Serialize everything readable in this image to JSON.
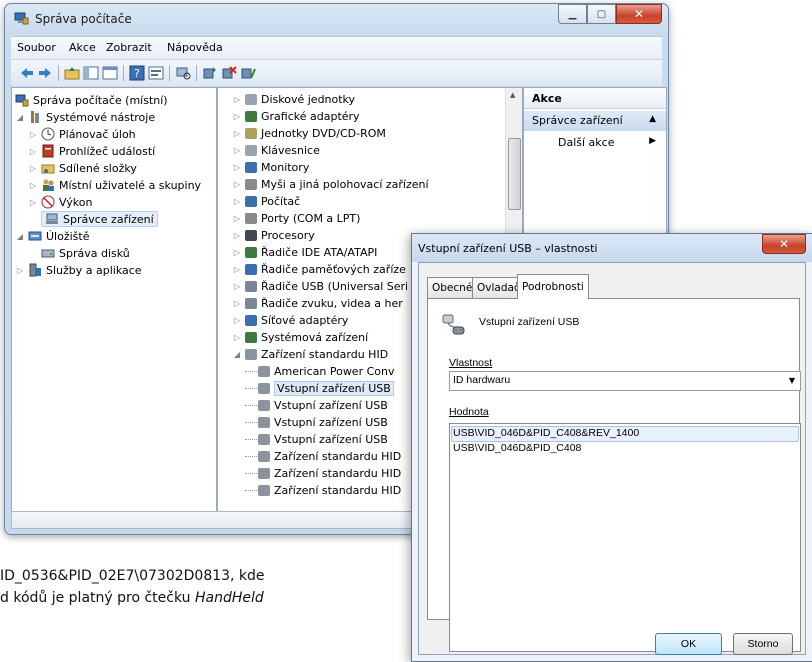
{
  "window": {
    "title": "Správa počítače",
    "menu": [
      "Soubor",
      "Akce",
      "Zobrazit",
      "Nápověda"
    ]
  },
  "tree": [
    {
      "label": "Správa počítače (místní)",
      "icon": "computer-management-icon"
    },
    {
      "label": "Systémové nástroje",
      "icon": "tools-icon"
    },
    {
      "label": "Plánovač úloh",
      "icon": "clock-icon"
    },
    {
      "label": "Prohlížeč událostí",
      "icon": "event-viewer-icon"
    },
    {
      "label": "Sdílené složky",
      "icon": "shared-folder-icon"
    },
    {
      "label": "Místní uživatelé a skupiny",
      "icon": "users-icon"
    },
    {
      "label": "Výkon",
      "icon": "performance-icon"
    },
    {
      "label": "Správce zařízení",
      "icon": "device-manager-icon"
    },
    {
      "label": "Úložiště",
      "icon": "storage-icon"
    },
    {
      "label": "Správa disků",
      "icon": "disk-icon"
    },
    {
      "label": "Služby a aplikace",
      "icon": "services-icon"
    }
  ],
  "devices": [
    "Diskové jednotky",
    "Grafické adaptéry",
    "Jednotky DVD/CD-ROM",
    "Klávesnice",
    "Monitory",
    "Myši a jiná polohovací zařízení",
    "Počítač",
    "Porty (COM a LPT)",
    "Procesory",
    "Řadiče IDE ATA/ATAPI",
    "Řadiče paměťových zaříze",
    "Řadiče USB (Universal Seri",
    "Řadiče zvuku, videa a her",
    "Síťové adaptéry",
    "Systémová zařízení",
    "Zařízení standardu HID",
    "American Power Conv",
    "Vstupní zařízení USB",
    "Vstupní zařízení USB",
    "Vstupní zařízení USB",
    "Vstupní zařízení USB",
    "Zařízení standardu HID",
    "Zařízení standardu HID",
    "Zařízení standardu HID"
  ],
  "actions": {
    "header": "Akce",
    "section": "Správce zařízení",
    "more": "Další akce"
  },
  "dialog": {
    "title": "Vstupní zařízení USB – vlastnosti",
    "tabs": [
      "Obecné",
      "Ovladač",
      "Podrobnosti"
    ],
    "device_name": "Vstupní zařízení USB",
    "property_label": "Vlastnost",
    "property_value": "ID hardwaru",
    "value_label": "Hodnota",
    "values": [
      "USB\\VID_046D&PID_C408&REV_1400",
      "USB\\VID_046D&PID_C408"
    ],
    "ok": "OK",
    "cancel": "Storno"
  },
  "document": {
    "line1": "ID_0536&PID_02E7\\07302D0813, kde",
    "line2_prefix": "d kódů je platný pro čtečku ",
    "line2_italic": "HandHeld"
  }
}
